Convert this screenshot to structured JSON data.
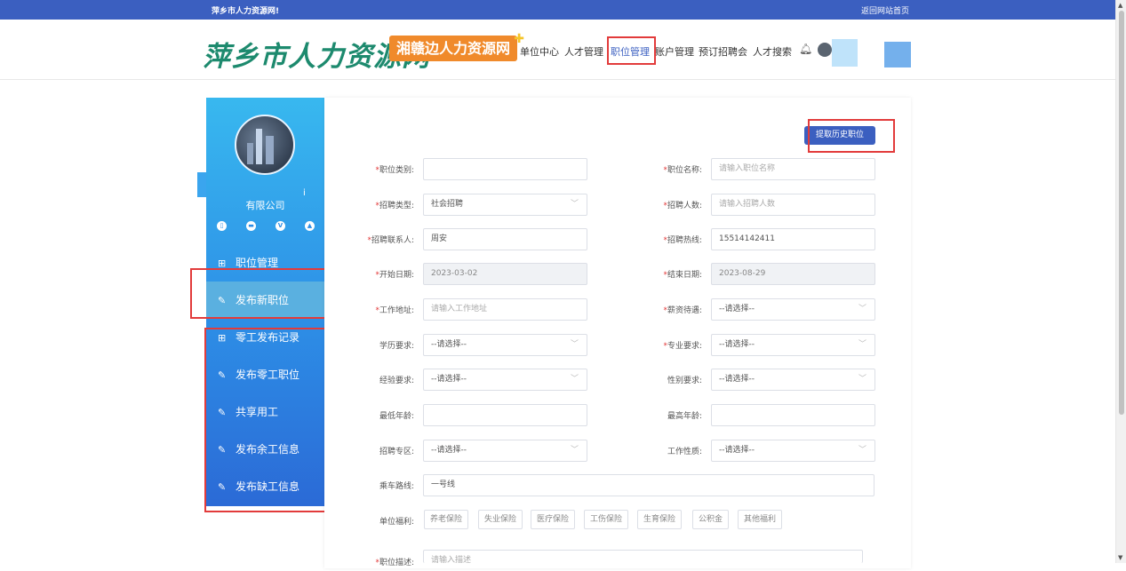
{
  "topbar": {
    "site_name": "萍乡市人力资源网!",
    "home_link": "返回网站首页"
  },
  "header": {
    "logo": "萍乡市人力资源网",
    "badge": "湘赣边人力资源网",
    "nav": [
      "单位中心",
      "人才管理",
      "职位管理",
      "账户管理",
      "预订招聘会",
      "人才搜索"
    ]
  },
  "sidebar": {
    "info_icon": "i",
    "company": "有限公司",
    "icons": [
      "phone-icon",
      "mail-icon",
      "verified-icon",
      "image-icon"
    ],
    "items": [
      {
        "label": "职位管理",
        "icon": "grid-icon"
      },
      {
        "label": "发布新职位",
        "icon": "edit-icon",
        "active": true
      },
      {
        "label": "零工发布记录",
        "icon": "grid-icon"
      },
      {
        "label": "发布零工职位",
        "icon": "edit-icon"
      },
      {
        "label": "共享用工",
        "icon": "edit-icon"
      },
      {
        "label": "发布余工信息",
        "icon": "edit-icon"
      },
      {
        "label": "发布缺工信息",
        "icon": "edit-icon"
      }
    ]
  },
  "form": {
    "history_button": "提取历史职位",
    "job_category": {
      "label": "职位类别:",
      "value": ""
    },
    "job_name": {
      "label": "职位名称:",
      "placeholder": "请输入职位名称"
    },
    "recruit_type": {
      "label": "招聘类型:",
      "value": "社会招聘"
    },
    "recruit_count": {
      "label": "招聘人数:",
      "placeholder": "请输入招聘人数"
    },
    "contact": {
      "label": "招聘联系人:",
      "value": "周安"
    },
    "hotline": {
      "label": "招聘热线:",
      "value": "15514142411"
    },
    "start_date": {
      "label": "开始日期:",
      "value": "2023-03-02"
    },
    "end_date": {
      "label": "结束日期:",
      "value": "2023-08-29"
    },
    "work_address": {
      "label": "工作地址:",
      "placeholder": "请输入工作地址"
    },
    "salary": {
      "label": "薪资待遇:",
      "value": "--请选择--"
    },
    "education": {
      "label": "学历要求:",
      "value": "--请选择--"
    },
    "major": {
      "label": "专业要求:",
      "value": "--请选择--"
    },
    "experience": {
      "label": "经验要求:",
      "value": "--请选择--"
    },
    "gender": {
      "label": "性别要求:",
      "value": "--请选择--"
    },
    "min_age": {
      "label": "最低年龄:",
      "value": ""
    },
    "max_age": {
      "label": "最高年龄:",
      "value": ""
    },
    "zone": {
      "label": "招聘专区:",
      "value": "--请选择--"
    },
    "job_nature": {
      "label": "工作性质:",
      "value": "--请选择--"
    },
    "bus_route": {
      "label": "乘车路线:",
      "value": "一号线"
    },
    "benefits": {
      "label": "单位福利:",
      "tags": [
        "养老保险",
        "失业保险",
        "医疗保险",
        "工伤保险",
        "生育保险",
        "公积金",
        "其他福利"
      ]
    },
    "description": {
      "label": "职位描述:",
      "placeholder": "请输入描述"
    }
  }
}
